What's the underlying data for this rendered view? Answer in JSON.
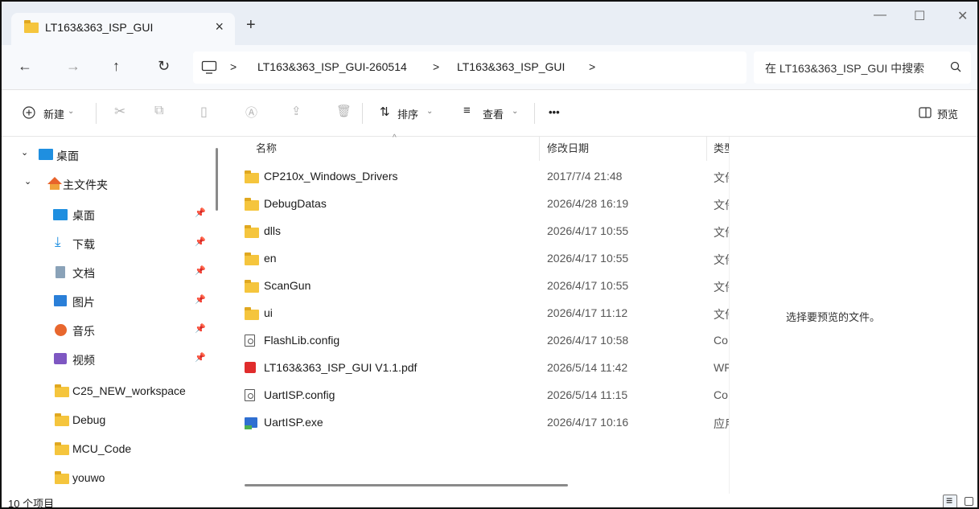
{
  "window": {
    "tab_title": "LT163&363_ISP_GUI",
    "close_tab": "×",
    "new_tab": "+",
    "minimize": "—",
    "maximize": "☐",
    "close": "✕"
  },
  "nav": {
    "back": "←",
    "forward": "→",
    "up": "↑",
    "refresh": "↻"
  },
  "breadcrumbs": [
    {
      "sep": ">",
      "label": "LT163&363_ISP_GUI-260514"
    },
    {
      "sep": ">",
      "label": "LT163&363_ISP_GUI"
    },
    {
      "sep": ">",
      "label": ""
    }
  ],
  "search": {
    "placeholder": "在 LT163&363_ISP_GUI 中搜索"
  },
  "toolbar": {
    "new": "新建",
    "sort": "排序",
    "view": "查看",
    "more": "•••",
    "preview": "预览"
  },
  "sidebar": {
    "top": [
      {
        "label": "桌面",
        "icon": "desktop-icon"
      },
      {
        "label": "主文件夹",
        "icon": "home-icon"
      }
    ],
    "quick": [
      {
        "label": "桌面",
        "icon": "desktop-icon",
        "pinned": true
      },
      {
        "label": "下载",
        "icon": "download-icon",
        "pinned": true
      },
      {
        "label": "文档",
        "icon": "document-icon",
        "pinned": true
      },
      {
        "label": "图片",
        "icon": "pictures-icon",
        "pinned": true
      },
      {
        "label": "音乐",
        "icon": "music-icon",
        "pinned": true
      },
      {
        "label": "视频",
        "icon": "video-icon",
        "pinned": true
      },
      {
        "label": "C25_NEW_workspace",
        "icon": "folder-icon",
        "pinned": false
      },
      {
        "label": "Debug",
        "icon": "folder-icon",
        "pinned": false
      },
      {
        "label": "MCU_Code",
        "icon": "folder-icon",
        "pinned": false
      },
      {
        "label": "youwo",
        "icon": "folder-icon",
        "pinned": false
      }
    ]
  },
  "columns": {
    "name": "名称",
    "date": "修改日期",
    "type": "类型"
  },
  "files": [
    {
      "name": "CP210x_Windows_Drivers",
      "date": "2017/7/4 21:48",
      "type": "文件夹",
      "icon": "folder-icon"
    },
    {
      "name": "DebugDatas",
      "date": "2026/4/28 16:19",
      "type": "文件夹",
      "icon": "folder-icon"
    },
    {
      "name": "dlls",
      "date": "2026/4/17 10:55",
      "type": "文件夹",
      "icon": "folder-icon"
    },
    {
      "name": "en",
      "date": "2026/4/17 10:55",
      "type": "文件夹",
      "icon": "folder-icon"
    },
    {
      "name": "ScanGun",
      "date": "2026/4/17 10:55",
      "type": "文件夹",
      "icon": "folder-icon"
    },
    {
      "name": "ui",
      "date": "2026/4/17 11:12",
      "type": "文件夹",
      "icon": "folder-icon"
    },
    {
      "name": "FlashLib.config",
      "date": "2026/4/17 10:58",
      "type": "Co",
      "icon": "config-file-icon"
    },
    {
      "name": "LT163&363_ISP_GUI V1.1.pdf",
      "date": "2026/5/14 11:42",
      "type": "WF",
      "icon": "pdf-file-icon"
    },
    {
      "name": "UartISP.config",
      "date": "2026/5/14 11:15",
      "type": "Co",
      "icon": "config-file-icon"
    },
    {
      "name": "UartISP.exe",
      "date": "2026/4/17 10:16",
      "type": "应用",
      "icon": "exe-file-icon"
    }
  ],
  "preview_message": "选择要预览的文件。",
  "status": {
    "item_count": "10 个项目"
  },
  "colors": {
    "titlebar": "#e9eef5",
    "folder": "#f5c53d",
    "accent": "#1f8fe0"
  }
}
